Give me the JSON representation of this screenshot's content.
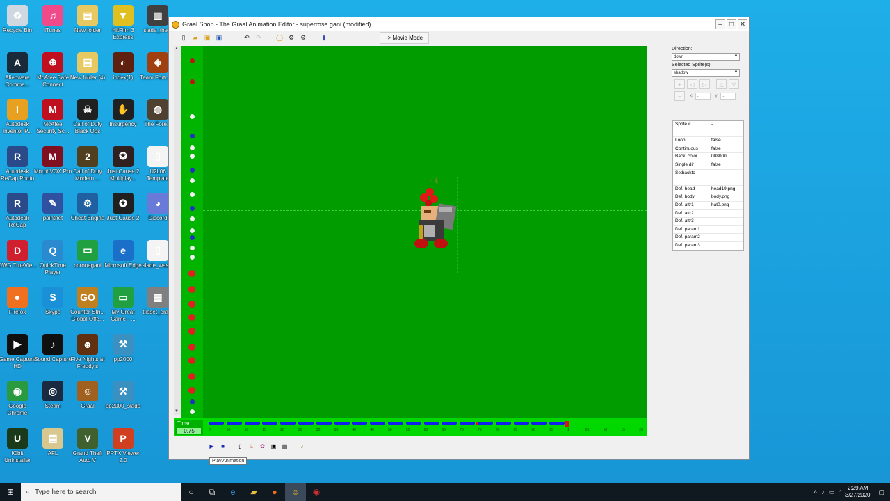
{
  "desktop": {
    "icons": [
      {
        "label": "Recycle Bin",
        "glyph": "♻",
        "color": "#cfd8e0"
      },
      {
        "label": "Alienware Comma...",
        "glyph": "A",
        "color": "#1b2a3a"
      },
      {
        "label": "Autodesk Inventor P...",
        "glyph": "I",
        "color": "#e8a020"
      },
      {
        "label": "Autodesk ReCap Photo",
        "glyph": "R",
        "color": "#2a4a8a"
      },
      {
        "label": "Autodesk ReCap",
        "glyph": "R",
        "color": "#2a4a8a"
      },
      {
        "label": "DWG TrueVie...",
        "glyph": "D",
        "color": "#d02030"
      },
      {
        "label": "Firefox",
        "glyph": "●",
        "color": "#f07020"
      },
      {
        "label": "Game Capture HD",
        "glyph": "▶",
        "color": "#101010"
      },
      {
        "label": "Google Chrome",
        "glyph": "◉",
        "color": "#2a9a40"
      },
      {
        "label": "IObit Uninstaller",
        "glyph": "U",
        "color": "#1a3a1a"
      },
      {
        "label": "iTunes",
        "glyph": "♫",
        "color": "#f04a8a"
      },
      {
        "label": "McAfee Safe Connect",
        "glyph": "⊕",
        "color": "#c01020"
      },
      {
        "label": "McAfee Security Sc...",
        "glyph": "M",
        "color": "#c01020"
      },
      {
        "label": "MorphVOX Pro",
        "glyph": "M",
        "color": "#801020"
      },
      {
        "label": "paintnet",
        "glyph": "✎",
        "color": "#3050a0"
      },
      {
        "label": "QuickTime Player",
        "glyph": "Q",
        "color": "#2a8ad0"
      },
      {
        "label": "Skype",
        "glyph": "S",
        "color": "#1a90d8"
      },
      {
        "label": "Sound Capture",
        "glyph": "♪",
        "color": "#101010"
      },
      {
        "label": "Steam",
        "glyph": "◎",
        "color": "#1a2a40"
      },
      {
        "label": "AFL",
        "glyph": "▤",
        "color": "#d8c890"
      },
      {
        "label": "New folder",
        "glyph": "▤",
        "color": "#e8c860"
      },
      {
        "label": "New folder (4)",
        "glyph": "▤",
        "color": "#e8c860"
      },
      {
        "label": "Call of Duty Black Ops",
        "glyph": "☠",
        "color": "#202020"
      },
      {
        "label": "Call of Duty Modern ...",
        "glyph": "2",
        "color": "#504020"
      },
      {
        "label": "Cheat Engine",
        "glyph": "⚙",
        "color": "#2060a0"
      },
      {
        "label": "coronagani",
        "glyph": "▭",
        "color": "#20a040"
      },
      {
        "label": "Counter-Stri... Global Offe...",
        "glyph": "GO",
        "color": "#c08020"
      },
      {
        "label": "Five Nights at Freddy's",
        "glyph": "☻",
        "color": "#603010"
      },
      {
        "label": "Graal",
        "glyph": "☺",
        "color": "#a06020"
      },
      {
        "label": "Grand Theft Auto V",
        "glyph": "V",
        "color": "#406030"
      },
      {
        "label": "HitFilm 3 Express",
        "glyph": "▼",
        "color": "#e0c020"
      },
      {
        "label": "index(1)",
        "glyph": "◐",
        "color": "#602010"
      },
      {
        "label": "Insurgency",
        "glyph": "✋",
        "color": "#202020"
      },
      {
        "label": "Just Cause 2 Multiplay...",
        "glyph": "✪",
        "color": "#302020"
      },
      {
        "label": "Just Cause 2",
        "glyph": "✪",
        "color": "#202020"
      },
      {
        "label": "Microsoft Edge",
        "glyph": "e",
        "color": "#1a70c8"
      },
      {
        "label": "My Great Game - ...",
        "glyph": "▭",
        "color": "#20a040"
      },
      {
        "label": "pp2000",
        "glyph": "⚒",
        "color": "#3a90c0"
      },
      {
        "label": "pp2000_slade",
        "glyph": "⚒",
        "color": "#3a90c0"
      },
      {
        "label": "PPTX Viewer 2.0",
        "glyph": "P",
        "color": "#d04020"
      },
      {
        "label": "slade_the...",
        "glyph": "▥",
        "color": "#404040"
      },
      {
        "label": "Team Fortr... 2",
        "glyph": "◈",
        "color": "#a04010"
      },
      {
        "label": "The Fore...",
        "glyph": "◍",
        "color": "#504030"
      },
      {
        "label": "U2L06 Template",
        "glyph": "▯",
        "color": "#f4f4f4"
      },
      {
        "label": "Discord",
        "glyph": "◕",
        "color": "#6a7ad8"
      },
      {
        "label": "slade_was...",
        "glyph": "▯",
        "color": "#f4f4f4"
      },
      {
        "label": "tileset_era...",
        "glyph": "▦",
        "color": "#808080"
      }
    ]
  },
  "window": {
    "title": "Graal Shop - The Graal Animation Editor - superrose.gani (modified)",
    "movie_mode": "-> Movie Mode",
    "time_label": "Time",
    "time_value": "0.75",
    "tooltip": "Play Animation",
    "direction_label": "Direction:",
    "direction_value": "down",
    "selected_sprites_label": "Selected Sprite(s)",
    "selected_sprites_value": "shadow",
    "x_label": "x:",
    "y_label": "y:",
    "x_value": "-",
    "y_value": "-",
    "properties": [
      {
        "k": "Sprite #",
        "v": "-"
      },
      {
        "k": "",
        "v": ""
      },
      {
        "k": "Loop",
        "v": "false"
      },
      {
        "k": "Continuous",
        "v": "false"
      },
      {
        "k": "Back. color",
        "v": "008000"
      },
      {
        "k": "Single dir",
        "v": "false"
      },
      {
        "k": "Setbackto",
        "v": ""
      },
      {
        "k": "",
        "v": ""
      },
      {
        "k": "Def. head",
        "v": "head19.png"
      },
      {
        "k": "Def. body",
        "v": "body.png"
      },
      {
        "k": "Def. attr1",
        "v": "hat0.png"
      },
      {
        "k": "Def. attr2",
        "v": ""
      },
      {
        "k": "Def. attr3",
        "v": ""
      },
      {
        "k": "Def. param1",
        "v": ""
      },
      {
        "k": "Def. param2",
        "v": ""
      },
      {
        "k": "Def. param3",
        "v": ""
      }
    ],
    "ruler_ticks": [
      "0",
      "05",
      "10",
      "15",
      "20",
      "25",
      "30",
      "35",
      "40",
      "45",
      "50",
      "55",
      "60",
      "65",
      "70",
      "75",
      "80",
      "85",
      "90",
      "95",
      "1",
      "05",
      "10",
      "15",
      "20"
    ],
    "colors": {
      "stage": "#009c00",
      "strip": "#00b400",
      "timeline": "#00d800",
      "frames": "#1020ee",
      "marker": "#e01010"
    }
  },
  "taskbar": {
    "search_placeholder": "Type here to search",
    "time": "2:29 AM",
    "date": "3/27/2020"
  }
}
